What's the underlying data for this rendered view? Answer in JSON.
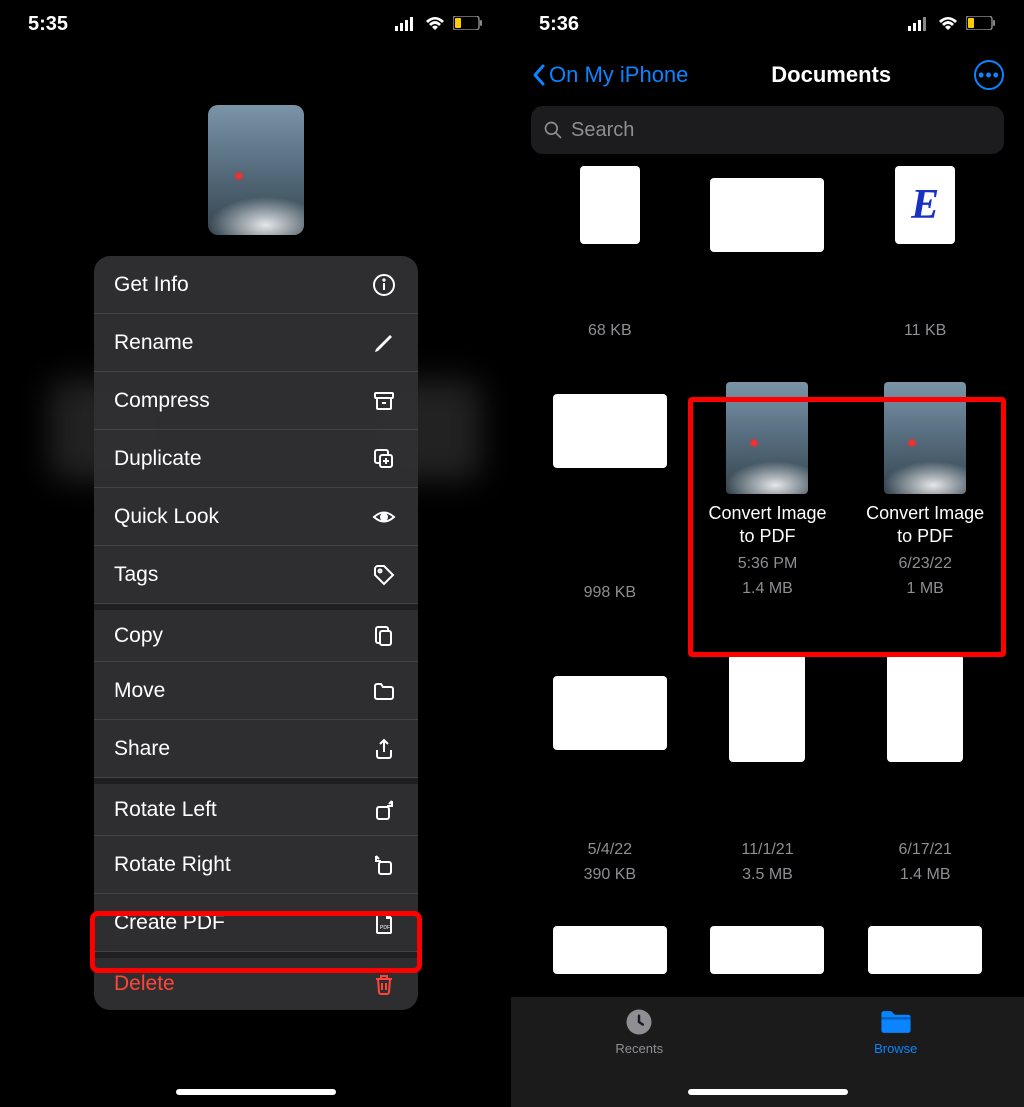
{
  "left": {
    "status_time": "5:35",
    "menu": [
      {
        "label": "Get Info",
        "icon": "info-icon"
      },
      {
        "label": "Rename",
        "icon": "pencil-icon"
      },
      {
        "label": "Compress",
        "icon": "archive-icon"
      },
      {
        "label": "Duplicate",
        "icon": "duplicate-icon"
      },
      {
        "label": "Quick Look",
        "icon": "eye-icon"
      },
      {
        "label": "Tags",
        "icon": "tag-icon"
      },
      {
        "label": "Copy",
        "icon": "copy-icon"
      },
      {
        "label": "Move",
        "icon": "folder-icon"
      },
      {
        "label": "Share",
        "icon": "share-icon"
      },
      {
        "label": "Rotate Left",
        "icon": "rotate-left-icon"
      },
      {
        "label": "Rotate Right",
        "icon": "rotate-right-icon"
      },
      {
        "label": "Create PDF",
        "icon": "pdf-icon"
      },
      {
        "label": "Delete",
        "icon": "trash-icon"
      }
    ]
  },
  "right": {
    "status_time": "5:36",
    "nav_back": "On My iPhone",
    "nav_title": "Documents",
    "search_placeholder": "Search",
    "tabs": {
      "recents": "Recents",
      "browse": "Browse"
    },
    "files": {
      "row1": [
        {
          "size": "68 KB"
        },
        {
          "size": ""
        },
        {
          "size": "11 KB"
        }
      ],
      "row2": [
        {
          "size": "998 KB"
        },
        {
          "name": "Convert Image to PDF",
          "time": "5:36 PM",
          "size": "1.4 MB"
        },
        {
          "name": "Convert Image to PDF",
          "time": "6/23/22",
          "size": "1 MB"
        }
      ],
      "row3": [
        {
          "time": "5/4/22",
          "size": "390 KB"
        },
        {
          "time": "11/1/21",
          "size": "3.5 MB"
        },
        {
          "time": "6/17/21",
          "size": "1.4 MB"
        }
      ]
    }
  }
}
